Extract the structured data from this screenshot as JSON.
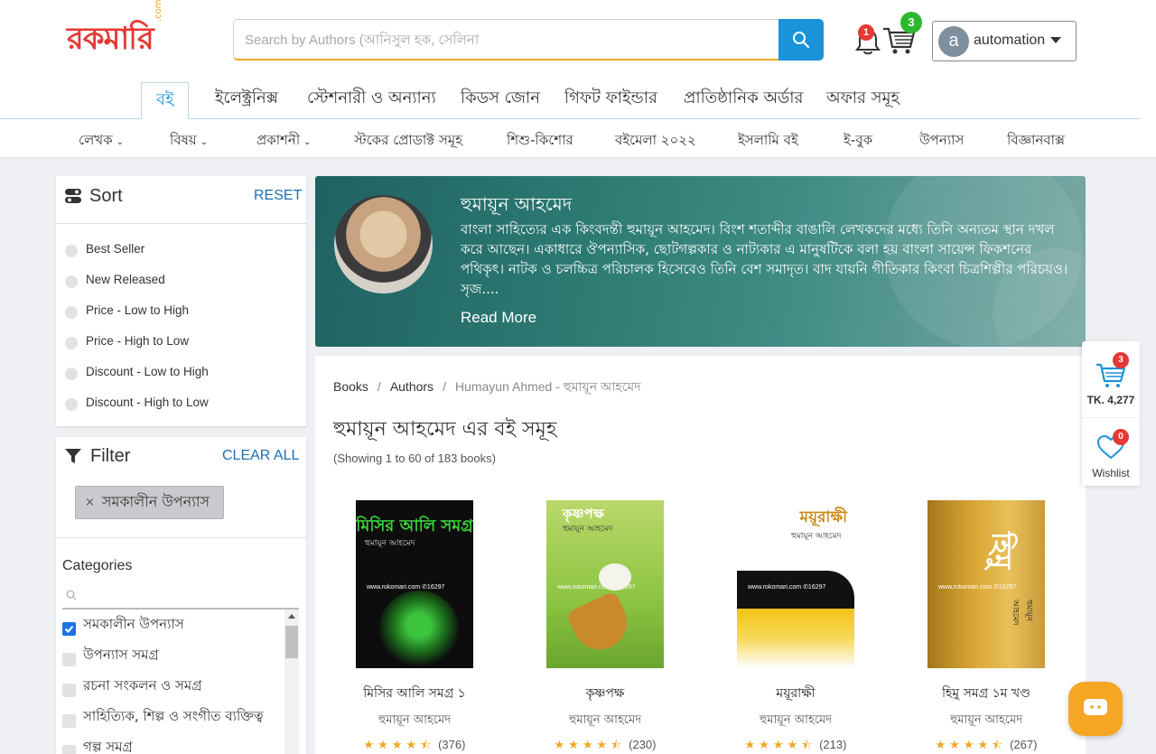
{
  "header": {
    "logo_text": "রকমারি",
    "logo_suffix": ".com",
    "search_placeholder": "Search by Authors (আনিসুল হক, সেলিনা",
    "notification_count": "1",
    "cart_count": "3",
    "user_initial": "a",
    "user_name": "automation"
  },
  "main_tabs": [
    {
      "label": "বই"
    },
    {
      "label": "ইলেক্ট্রনিক্স"
    },
    {
      "label": "স্টেশনারী ও অন্যান্য"
    },
    {
      "label": "কিডস জোন"
    },
    {
      "label": "গিফট ফাইন্ডার"
    },
    {
      "label": "প্রাতিষ্ঠানিক অর্ডার"
    },
    {
      "label": "অফার সমূহ"
    }
  ],
  "sub_nav": [
    {
      "label": "লেখক"
    },
    {
      "label": "বিষয়"
    },
    {
      "label": "প্রকাশনী"
    },
    {
      "label": "স্টকের প্রোডাক্ট সমূহ"
    },
    {
      "label": "শিশু-কিশোর"
    },
    {
      "label": "বইমেলা ২০২২"
    },
    {
      "label": "ইসলামি বই"
    },
    {
      "label": "ই-বুক"
    },
    {
      "label": "উপন্যাস"
    },
    {
      "label": "বিজ্ঞানবাক্স"
    }
  ],
  "sort": {
    "title": "Sort",
    "reset_label": "RESET",
    "options": [
      "Best Seller",
      "New Released",
      "Price - Low to High",
      "Price - High to Low",
      "Discount - Low to High",
      "Discount - High to Low"
    ]
  },
  "filter": {
    "title": "Filter",
    "clear_label": "CLEAR ALL",
    "active_chip": "সমকালীন উপন্যাস",
    "categories_title": "Categories",
    "categories": [
      {
        "label": "সমকালীন উপন্যাস",
        "checked": true
      },
      {
        "label": "উপন্যাস সমগ্র",
        "checked": false
      },
      {
        "label": "রচনা সংকলন ও সমগ্র",
        "checked": false
      },
      {
        "label": "সাহিত্যিক, শিল্প ও সংগীত ব্যক্তিত্ব",
        "checked": false
      },
      {
        "label": "গল্প সমগ্র",
        "checked": false
      }
    ]
  },
  "author": {
    "name": "হুমায়ূন আহমেদ",
    "bio": "বাংলা সাহিত্যের এক কিংবদন্তী হুমায়ূন আহমেদ। বিংশ শতাব্দীর বাঙালি লেখকদের মধ্যে তিনি অন্যতম স্থান দখল করে আছেন। একাধারে ঔপন্যাসিক, ছোটগল্পকার ও নাট্যকার এ মানুষটিকে বলা হয় বাংলা সায়েন্স ফিকশনের পথিকৃৎ। নাটক ও চলচ্চিত্র পরিচালক হিসেবেও তিনি বেশ সমাদৃত। বাদ যায়নি গীতিকার কিংবা চিত্রশিল্পীর পরিচয়ও। সৃজ....",
    "read_more": "Read More"
  },
  "breadcrumb": [
    "Books",
    "Authors",
    "Humayun Ahmed - হুমায়ূন আহমেদ"
  ],
  "page_title": "হুমায়ূন আহমেদ এর বই সমূহ",
  "showing": "(Showing 1 to 60 of 183 books)",
  "books": [
    {
      "title": "মিসির আলি সমগ্র ১",
      "author": "হুমায়ূন আহমেদ",
      "rating": 4.5,
      "reviews": "(376)",
      "cover_title": "মিসির আলি সমগ্র",
      "cover_author": "হুমায়ূন আহমেদ"
    },
    {
      "title": "কৃষ্ণপক্ষ",
      "author": "হুমায়ূন আহমেদ",
      "rating": 4.5,
      "reviews": "(230)",
      "cover_title": "কৃষ্ণপক্ষ",
      "cover_author": "হুমায়ূন আহমেদ"
    },
    {
      "title": "ময়ূরাক্ষী",
      "author": "হুমায়ূন আহমেদ",
      "rating": 4.5,
      "reviews": "(213)",
      "cover_title": "ময়ূরাক্ষী",
      "cover_author": "হুমায়ূন আহমেদ"
    },
    {
      "title": "হিমু সমগ্র ১ম খণ্ড",
      "author": "হুমায়ূন আহমেদ",
      "rating": 4.5,
      "reviews": "(267)",
      "cover_title": "হিমু",
      "cover_author": "হুমায়ূন আহমেদ"
    }
  ],
  "cover_url": "www.rokomari.com ✆16297",
  "floating_cart": {
    "count": "3",
    "amount": "TK. 4,277",
    "wishlist_count": "0",
    "wishlist_label": "Wishlist"
  },
  "colors": {
    "brand_red": "#e53935",
    "accent_blue": "#1a93d9",
    "accent_orange": "#f5a623",
    "banner_teal": "#2d7a73"
  }
}
